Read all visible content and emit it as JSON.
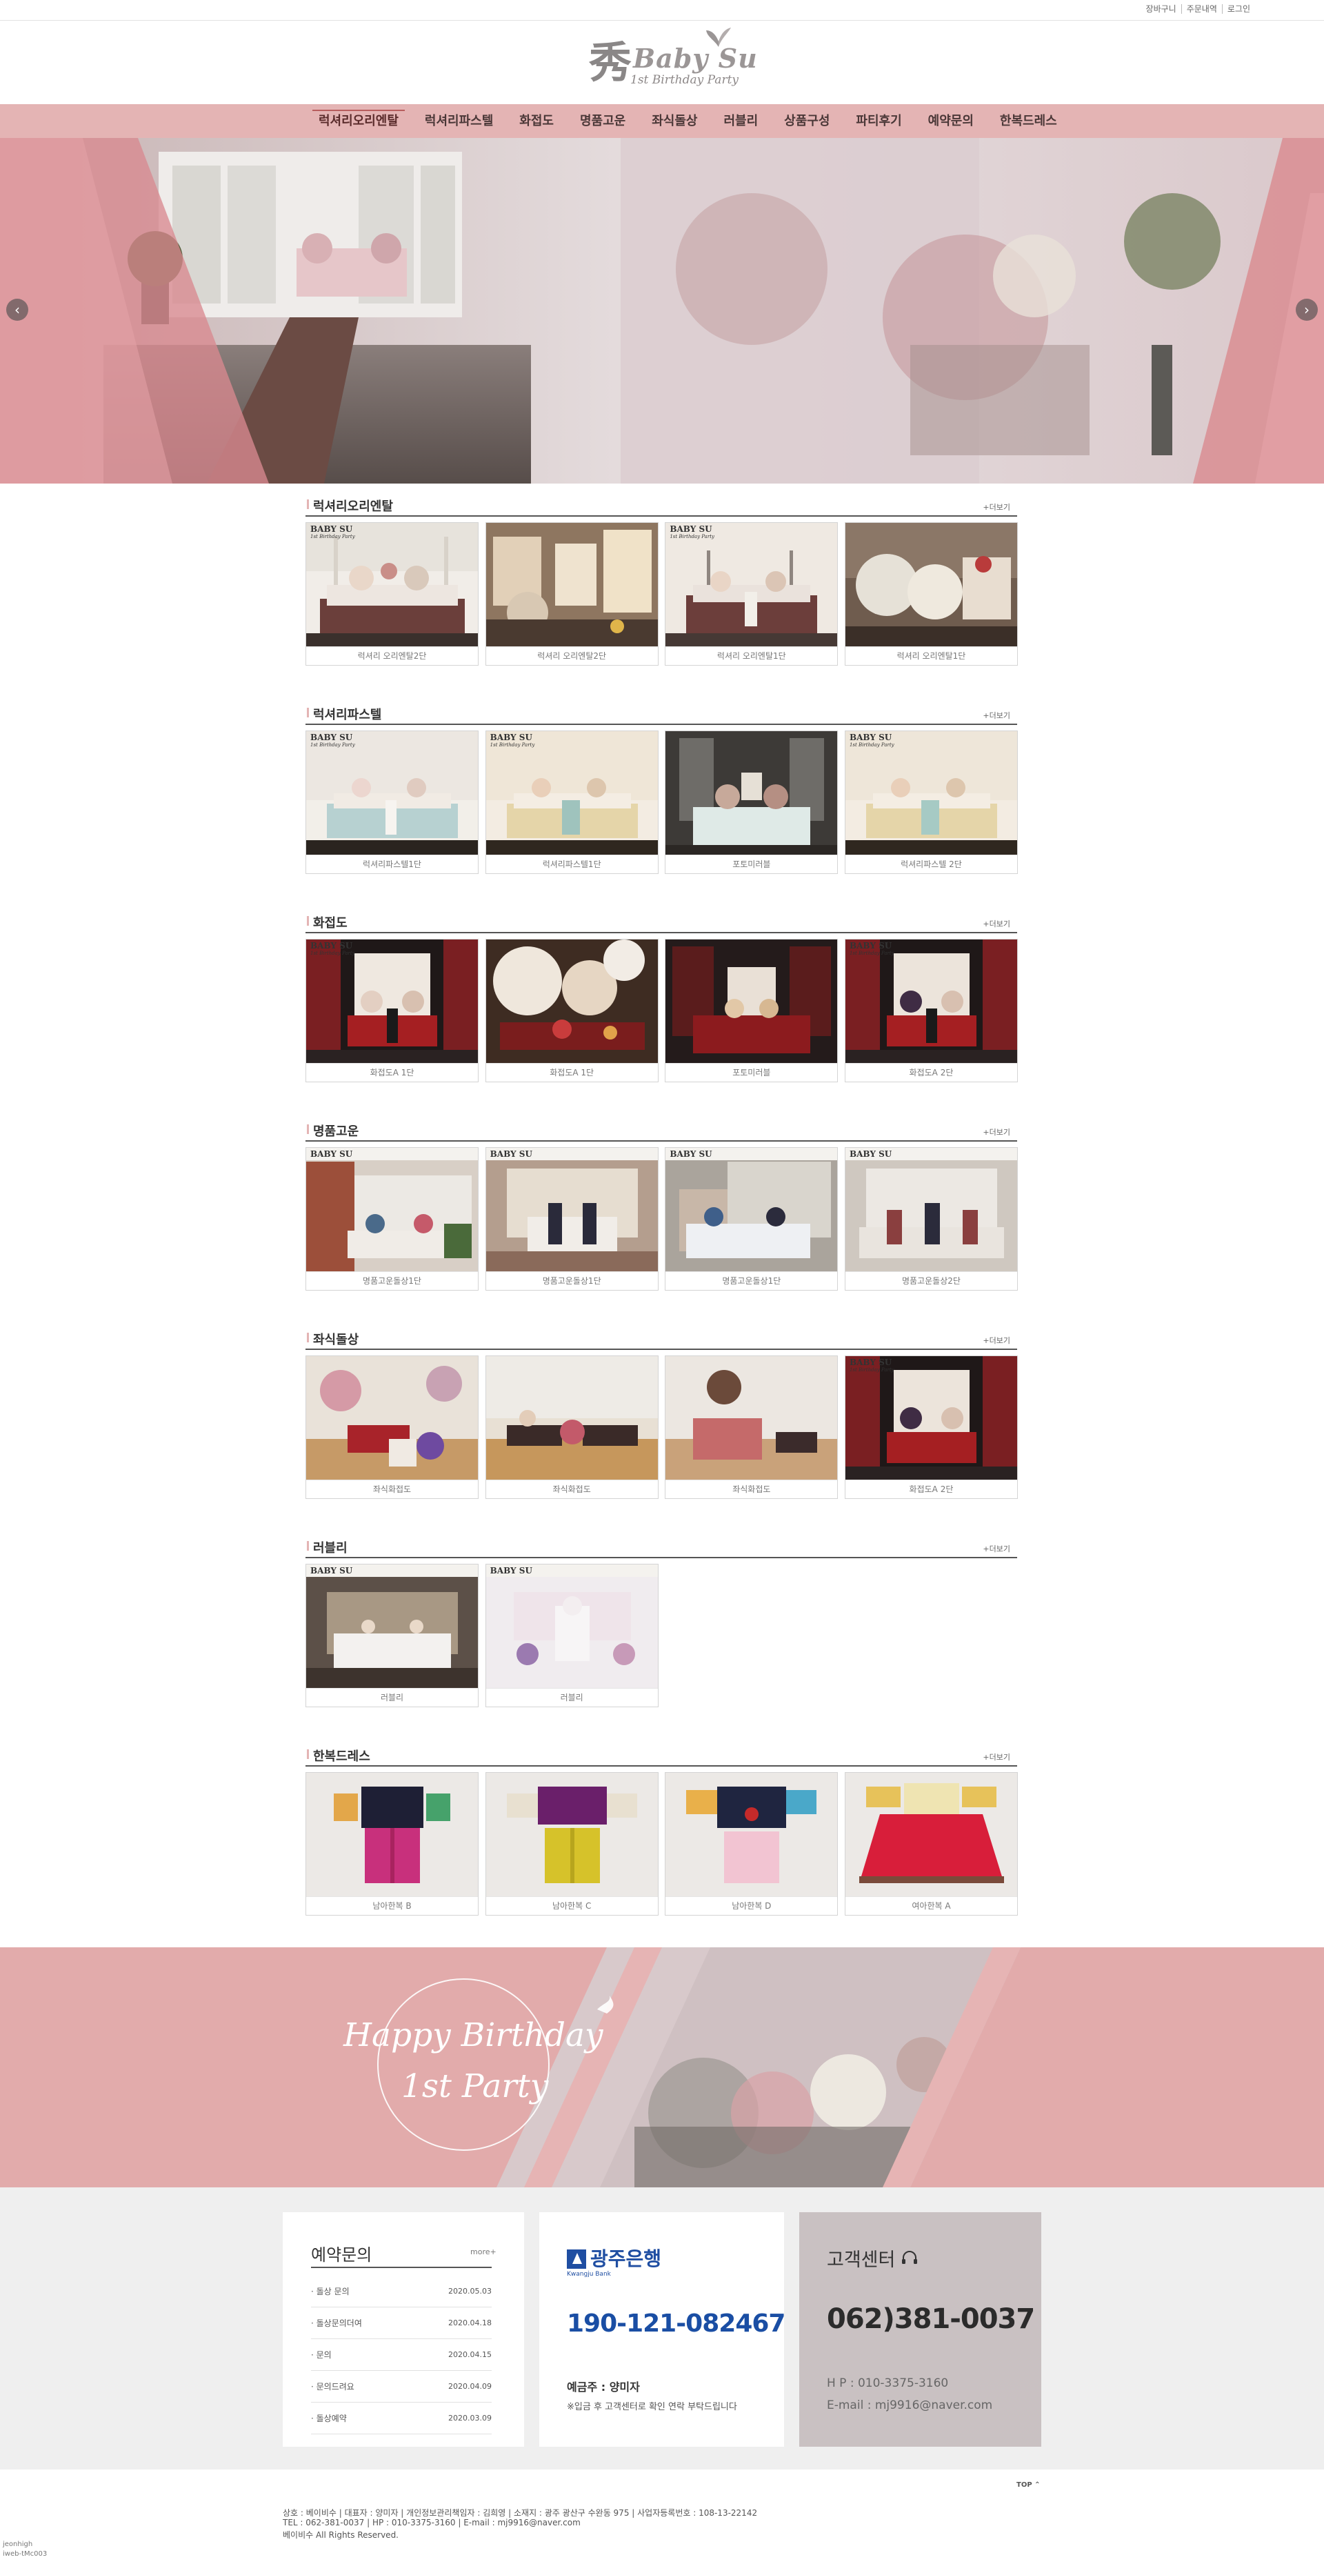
{
  "util_links": [
    "장바구니",
    "주문내역",
    "로그인"
  ],
  "logo": {
    "han": "秀",
    "baby": "Baby Su",
    "sub": "1st Birthday Party"
  },
  "nav": [
    "럭셔리오리엔탈",
    "럭셔리파스텔",
    "화접도",
    "명품고운",
    "좌식돌상",
    "러블리",
    "상품구성",
    "파티후기",
    "예약문의",
    "한복드레스"
  ],
  "slider": {
    "prev_icon": "chevron-left-icon",
    "next_icon": "chevron-right-icon"
  },
  "more_label": "+더보기",
  "sections": [
    {
      "title": "럭셔리오리엔탈",
      "items": [
        "럭셔리 오리엔탈2단",
        "럭셔리 오리엔탈2단",
        "럭셔리 오리엔탈1단",
        "럭셔리 오리엔탈1단"
      ]
    },
    {
      "title": "럭셔리파스텔",
      "items": [
        "럭셔리파스텔1단",
        "럭셔리파스텔1단",
        "포토미러블",
        "럭셔리파스텔 2단"
      ]
    },
    {
      "title": "화접도",
      "items": [
        "화접도A 1단",
        "화접도A 1단",
        "포토미러블",
        "화접도A 2단"
      ]
    },
    {
      "title": "명품고운",
      "items": [
        "명품고운돌상1단",
        "명품고운돌상1단",
        "명품고운돌상1단",
        "명품고운돌상2단"
      ]
    },
    {
      "title": "좌식돌상",
      "items": [
        "좌식화접도",
        "좌식화접도",
        "좌식화접도",
        "화접도A 2단"
      ]
    },
    {
      "title": "러블리",
      "items": [
        "러블리",
        "러블리"
      ]
    },
    {
      "title": "한복드레스",
      "items": [
        "남아한복 B",
        "남아한복 C",
        "남아한복 D",
        "여아한복 A"
      ]
    }
  ],
  "brand_mark": {
    "name": "BABY SU",
    "tagline": "1st Birthday Party"
  },
  "banner": {
    "line1": "Happy Birthday",
    "line2": "1st Party"
  },
  "reservation": {
    "title": "예약문의",
    "more": "more+",
    "items": [
      {
        "subject": "· 돌상 문의",
        "date": "2020.05.03"
      },
      {
        "subject": "· 돌상문의더여",
        "date": "2020.04.18"
      },
      {
        "subject": "· 문의",
        "date": "2020.04.15"
      },
      {
        "subject": "· 문의드려요",
        "date": "2020.04.09"
      },
      {
        "subject": "· 돌상예약",
        "date": "2020.03.09"
      }
    ]
  },
  "bank": {
    "name": "광주은행",
    "name_en": "Kwangju Bank",
    "account": "190-121-082467",
    "owner": "예금주 : 양미자",
    "note": "※입금 후 고객센터로 확인 연락 부탁드립니다"
  },
  "cs": {
    "title": "고객센터",
    "tel": "062)381-0037",
    "hp": "H P : 010-3375-3160",
    "email": "E-mail : mj9916@naver.com"
  },
  "footer": {
    "top": "TOP ⌃",
    "line1": "상호 : 베이비수 | 대표자 : 양미자 | 개인정보관리책임자 : 김희영 | 소재지 : 광주 광산구 수완동 975 | 사업자등록번호 : 108-13-22142",
    "line2": "TEL : 062-381-0037 | HP : 010-3375-3160 |  E-mail : mj9916@naver.com",
    "line3": "베이비수 All Rights Reserved.",
    "credit1": "jeonhigh",
    "credit2": "iweb-tMc003"
  },
  "colors": {
    "nav_bg": "#e4b4b4",
    "banner_bg": "#e0a9a9",
    "bank_blue": "#1f4ea2",
    "cs_bg": "#c9c1c2"
  }
}
